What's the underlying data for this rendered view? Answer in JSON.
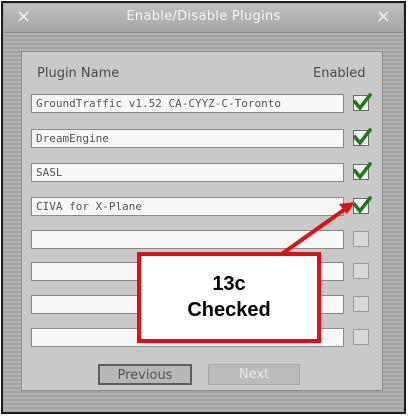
{
  "window": {
    "title": "Enable/Disable Plugins",
    "close_glyph": "×"
  },
  "columns": {
    "name": "Plugin Name",
    "enabled": "Enabled"
  },
  "rows": [
    {
      "name": "GroundTraffic v1.52 CA-CYYZ-C-Toronto",
      "checked": true
    },
    {
      "name": "DreamEngine",
      "checked": true
    },
    {
      "name": "SASL",
      "checked": true
    },
    {
      "name": "CIVA for X-Plane",
      "checked": true
    },
    {
      "name": "",
      "checked": false
    },
    {
      "name": "",
      "checked": false
    },
    {
      "name": "",
      "checked": false
    },
    {
      "name": "",
      "checked": false
    }
  ],
  "buttons": {
    "previous": "Previous",
    "next": "Next"
  },
  "callout": {
    "line1": "13c",
    "line2": "Checked"
  },
  "colors": {
    "check": "#1a7a1a",
    "callout_border": "#e01010"
  }
}
